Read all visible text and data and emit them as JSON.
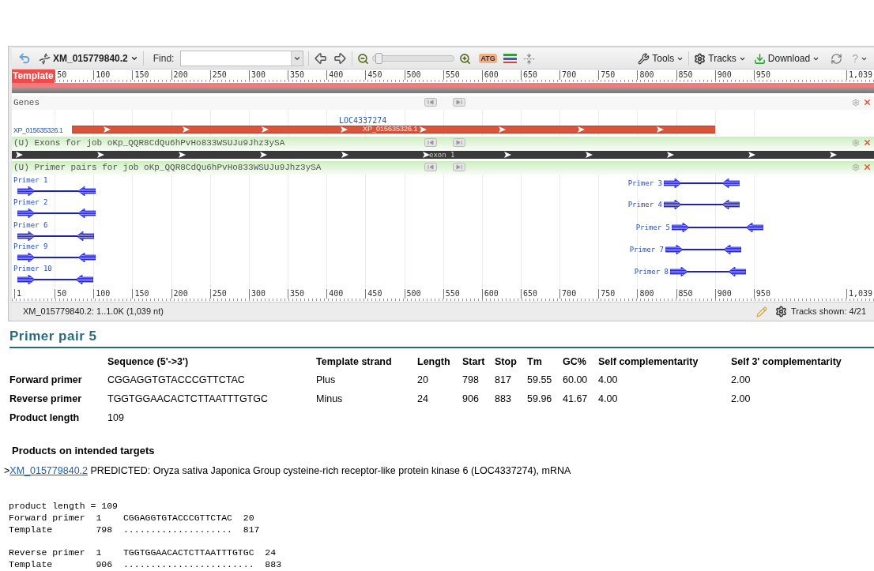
{
  "viewer": {
    "toolbar": {
      "accession": "XM_015779840.2",
      "find_label": "Find:",
      "sequence_icon": "ATG",
      "zoom_slider": {
        "level": 0.03
      },
      "tools": "Tools",
      "tracks": "Tracks",
      "download": "Download",
      "help": "?"
    },
    "ruler_top": {
      "label": "Template",
      "ticks": [
        "50",
        "100",
        "150",
        "200",
        "250",
        "300",
        "350",
        "400",
        "450",
        "500",
        "550",
        "600",
        "650",
        "700",
        "750",
        "800",
        "850",
        "900",
        "950",
        "1,039"
      ]
    },
    "genes_track": {
      "title": "Genes",
      "gene_label": "LOC4337274",
      "left_label": "XP_015635326.1",
      "bar_label": "XP_015635326.1"
    },
    "exons_track": {
      "title": "(U) Exons for job oKp_QQR8CdQu6hPvHo833WSUJu9Jhz3ySA",
      "bar_label": "exon 1"
    },
    "primers_track": {
      "title": "(U) Primer pairs for job oKp_QQR8CdQu6hPvHo833WSUJu9Jhz3ySA",
      "primers": [
        {
          "label": "Primer 1"
        },
        {
          "label": "Primer 2"
        },
        {
          "label": "Primer 6"
        },
        {
          "label": "Primer 9"
        },
        {
          "label": "Primer 10"
        },
        {
          "label": "Primer 3"
        },
        {
          "label": "Primer 4"
        },
        {
          "label": "Primer 5"
        },
        {
          "label": "Primer 7"
        },
        {
          "label": "Primer 8"
        }
      ]
    },
    "ruler_bottom": {
      "ticks": [
        "1",
        "50",
        "100",
        "150",
        "200",
        "250",
        "300",
        "350",
        "400",
        "450",
        "500",
        "550",
        "600",
        "650",
        "700",
        "750",
        "800",
        "850",
        "900",
        "950",
        "1,039"
      ]
    },
    "status_bar": {
      "location": "XM_015779840.2: 1..1.0K (1,039 nt)",
      "tracks_shown": "Tracks shown: 4/21"
    }
  },
  "primer_pair": {
    "title": "Primer pair 5",
    "columns": [
      "Sequence (5'->3')",
      "Template strand",
      "Length",
      "Start",
      "Stop",
      "Tm",
      "GC%",
      "Self complementarity",
      "Self 3' complementarity"
    ],
    "rows": [
      {
        "label": "Forward primer",
        "cells": [
          "CGGAGGTGTACCCGTTCTAC",
          "Plus",
          "20",
          "798",
          "817",
          "59.55",
          "60.00",
          "4.00",
          "2.00"
        ]
      },
      {
        "label": "Reverse primer",
        "cells": [
          "TGGTGGAACACTCTTAATTTGTGC",
          "Minus",
          "24",
          "906",
          "883",
          "59.96",
          "41.67",
          "4.00",
          "2.00"
        ]
      },
      {
        "label": "Product length",
        "cells": [
          "109"
        ]
      }
    ]
  },
  "products": {
    "heading": "Products on intended targets",
    "prefix": ">",
    "link": "XM_015779840.2",
    "description": " PREDICTED: Oryza sativa Japonica Group cysteine-rich receptor-like protein kinase 6 (LOC4337274), mRNA"
  },
  "alignment": {
    "blocks": [
      [
        "product length = 109",
        "Forward primer  1    CGGAGGTGTACCCGTTCTAC  20",
        "Template        798  ....................  817"
      ],
      [
        "Reverse primer  1    TGGTGGAACACTCTTAATTTGTGC  24",
        "Template        906  ........................  883"
      ]
    ]
  }
}
